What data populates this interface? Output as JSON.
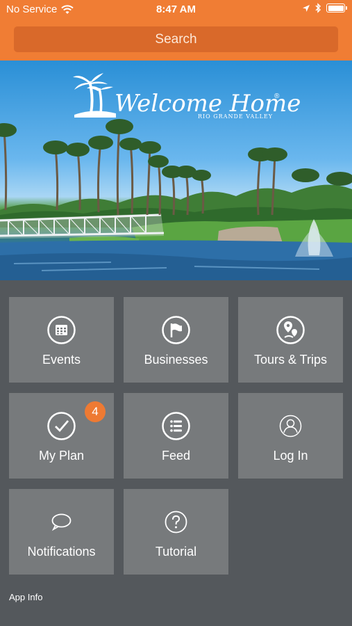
{
  "status_bar": {
    "carrier": "No Service",
    "time": "8:47 AM"
  },
  "search": {
    "label": "Search"
  },
  "hero": {
    "logo_title": "Welcome Home",
    "logo_mark": "®",
    "logo_subtitle": "RIO GRANDE VALLEY"
  },
  "tiles": [
    {
      "label": "Events",
      "icon": "calendar-icon"
    },
    {
      "label": "Businesses",
      "icon": "flag-icon"
    },
    {
      "label": "Tours & Trips",
      "icon": "map-pin-icon"
    },
    {
      "label": "My Plan",
      "icon": "checkmark-icon",
      "badge": "4"
    },
    {
      "label": "Feed",
      "icon": "list-icon"
    },
    {
      "label": "Log In",
      "icon": "user-icon"
    },
    {
      "label": "Notifications",
      "icon": "chat-bubble-icon"
    },
    {
      "label": "Tutorial",
      "icon": "question-icon"
    }
  ],
  "footer": {
    "app_info": "App Info"
  },
  "colors": {
    "header": "#f07d34",
    "search_bg": "#d9692a",
    "background": "#54585c",
    "tile": "#777a7c",
    "badge": "#ee7a33"
  }
}
